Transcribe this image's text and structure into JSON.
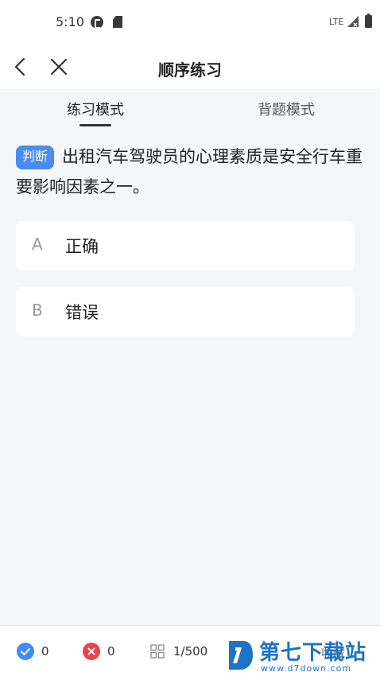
{
  "status_bar": {
    "time": "5:10",
    "network": "LTE",
    "icons": [
      "app-notification-icon",
      "sd-card-icon",
      "signal-icon",
      "battery-icon"
    ]
  },
  "nav": {
    "title": "顺序练习",
    "back_icon": "chevron-left-icon",
    "close_icon": "close-icon"
  },
  "tabs": [
    {
      "label": "练习模式",
      "active": true
    },
    {
      "label": "背题模式",
      "active": false
    }
  ],
  "question": {
    "tag": "判断",
    "text": "出租汽车驾驶员的心理素质是安全行车重要影响因素之一。"
  },
  "options": [
    {
      "letter": "A",
      "text": "正确"
    },
    {
      "letter": "B",
      "text": "错误"
    }
  ],
  "bottom_bar": {
    "correct_count": "0",
    "wrong_count": "0",
    "progress": "1/500",
    "favorite_label": "收藏"
  },
  "watermark": {
    "title": "第七下载站",
    "url": "www.d7down.com"
  },
  "colors": {
    "accent": "#4a8bf0",
    "correct": "#3d8ef0",
    "wrong": "#e8424a",
    "background": "#f5f6f8",
    "watermark": "#1e73c9"
  }
}
